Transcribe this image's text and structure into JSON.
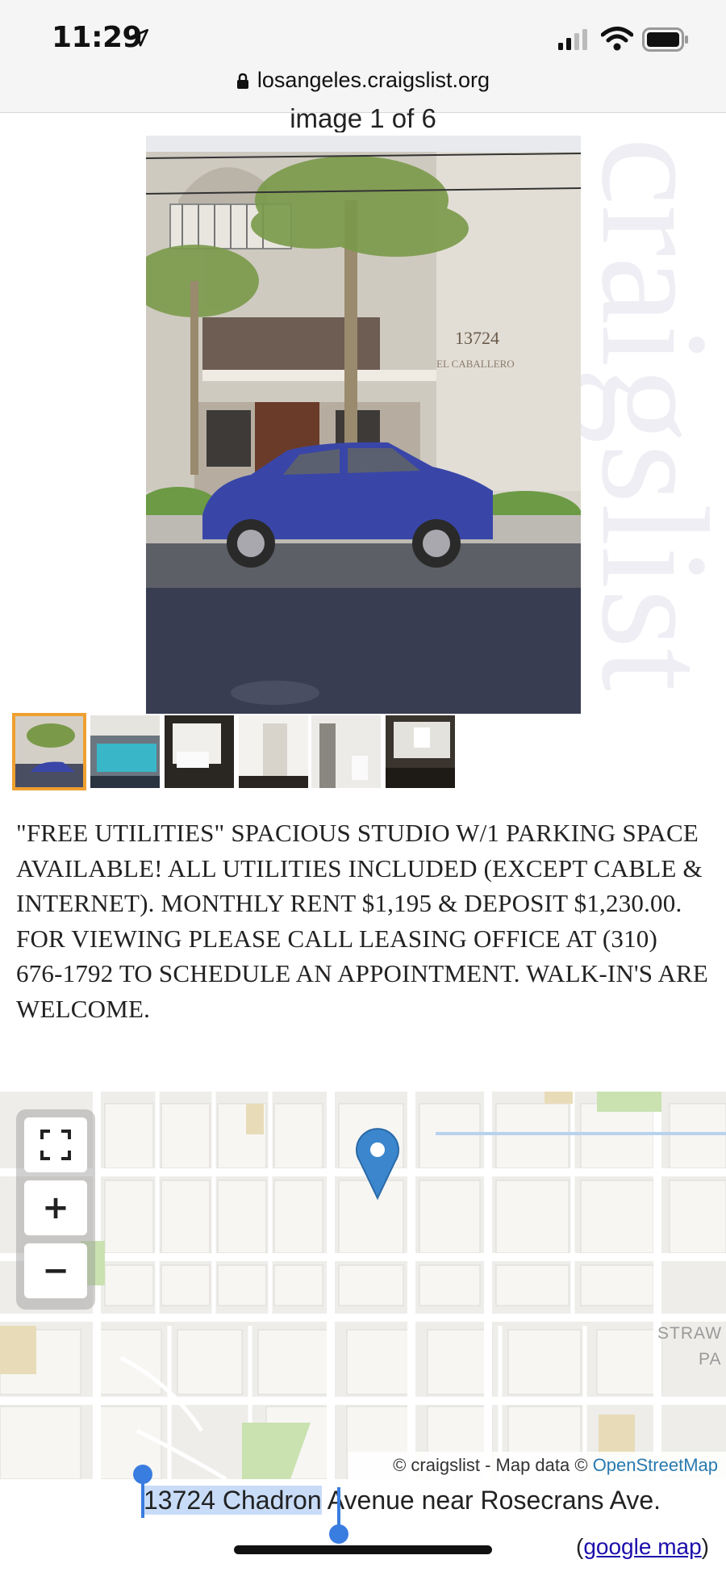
{
  "status_bar": {
    "time": "11:29",
    "icons": [
      "location-arrow-icon",
      "signal-icon",
      "wifi-icon",
      "battery-icon"
    ]
  },
  "browser": {
    "url": "losangeles.craigslist.org"
  },
  "gallery": {
    "caption": "image 1 of 6",
    "watermark": "craigslist",
    "main_image_description": "photo-apartment-building-blue-car",
    "thumbnails": [
      {
        "name": "photo-building-exterior",
        "active": true
      },
      {
        "name": "photo-pool",
        "active": false
      },
      {
        "name": "photo-kitchen",
        "active": false
      },
      {
        "name": "photo-room-doorway",
        "active": false
      },
      {
        "name": "photo-bathroom",
        "active": false
      },
      {
        "name": "photo-living-room",
        "active": false
      }
    ],
    "accent_color": "#f0a030"
  },
  "listing": {
    "description": "\"FREE UTILITIES\" SPACIOUS STUDIO W/1 PARKING SPACE AVAILABLE! ALL UTILITIES INCLUDED (EXCEPT CABLE & INTERNET). MONTHLY RENT $1,195 & DEPOSIT $1,230.00. FOR VIEWING PLEASE CALL LEASING OFFICE AT (310) 676-1792 TO SCHEDULE AN APPOINTMENT. WALK-IN'S ARE WELCOME."
  },
  "map": {
    "controls": {
      "fullscreen_icon": "fullscreen-icon",
      "zoom_in": "+",
      "zoom_out": "−"
    },
    "street_label_1": "STRAW",
    "street_label_2": "PA",
    "attribution_prefix": "© craigslist - Map data © ",
    "attribution_link": "OpenStreetMap",
    "pin_color": "#3b86cc"
  },
  "address": {
    "selected": "13724 Chadron",
    "rest": " Avenue near Rosecrans Ave.",
    "google_open": "(",
    "google_link": "google map",
    "google_close": ")"
  }
}
